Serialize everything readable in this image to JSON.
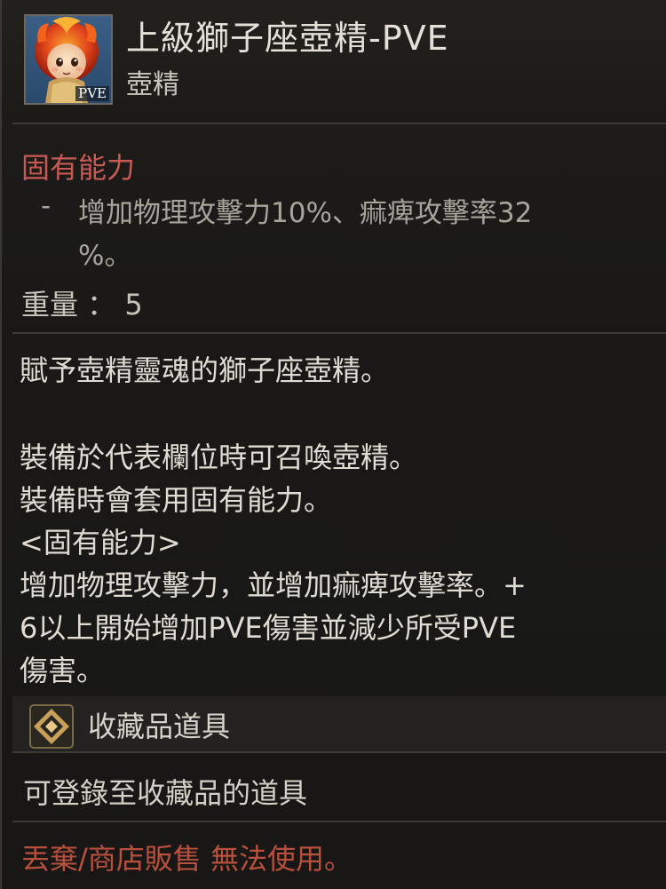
{
  "item": {
    "name": "上級獅子座壺精-PVE",
    "type": "壺精",
    "icon_badge": "PVE",
    "icon_name": "lion-spirit-portrait-icon"
  },
  "inherent": {
    "title": "固有能力",
    "bullet": "-",
    "line1": "增加物理攻擊力10%、痲痺攻擊率32",
    "line2": "%。"
  },
  "weight": {
    "text": "重量 ： 5"
  },
  "description": {
    "lines": [
      "賦予壺精靈魂的獅子座壺精。",
      "裝備於代表欄位時可召喚壺精。",
      "裝備時會套用固有能力。",
      "<固有能力>",
      "增加物理攻擊力，並增加痲痺攻擊率。+",
      "6以上開始增加PVE傷害並減少所受PVE",
      "傷害。"
    ]
  },
  "collection": {
    "label": "收藏品道具",
    "description": "可登錄至收藏品的道具",
    "icon_name": "collection-diamond-icon"
  },
  "footer": {
    "note": "丟棄/商店販售 無法使用。"
  },
  "colors": {
    "background": "#181715",
    "inherent_title": "#c85a55",
    "footer_note": "#b8503e",
    "accent_gold": "#c9a05a"
  }
}
